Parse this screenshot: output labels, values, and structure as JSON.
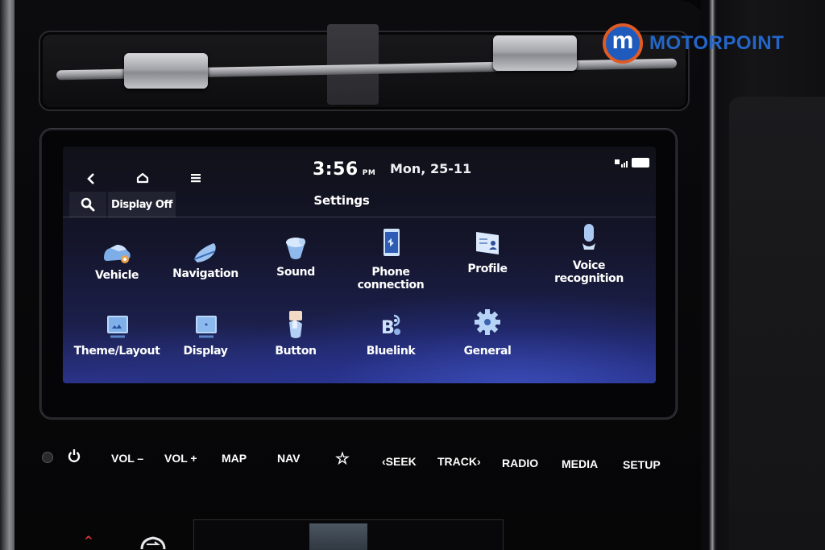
{
  "brand": {
    "logo_letter": "m",
    "logo_text": "MOTORPOINT",
    "colors": {
      "blue": "#1e5bbd",
      "orange": "#e05a24"
    }
  },
  "screen": {
    "statusbar": {
      "time": "3:56",
      "ampm": "PM",
      "date": "Mon, 25-11",
      "icons": [
        "back-icon",
        "home-icon",
        "menu-icon",
        "signal-icon",
        "battery-icon"
      ]
    },
    "toolbar": {
      "search_icon": "search-icon",
      "display_off_label": "Display Off",
      "title": "Settings"
    },
    "tiles": [
      {
        "label": "Vehicle",
        "icon": "vehicle-icon"
      },
      {
        "label": "Navigation",
        "icon": "navigation-icon"
      },
      {
        "label": "Sound",
        "icon": "speaker-icon"
      },
      {
        "label": "Phone\nconnection",
        "line1": "Phone",
        "line2": "connection",
        "icon": "phone-icon"
      },
      {
        "label": "Profile",
        "icon": "profile-card-icon"
      },
      {
        "label": "Voice\nrecognition",
        "line1": "Voice",
        "line2": "recognition",
        "icon": "microphone-icon"
      },
      {
        "label": "Theme/Layout",
        "icon": "theme-icon"
      },
      {
        "label": "Display",
        "icon": "display-icon"
      },
      {
        "label": "Button",
        "icon": "button-icon"
      },
      {
        "label": "Bluelink",
        "icon": "bluelink-icon"
      },
      {
        "label": "General",
        "icon": "gear-icon"
      }
    ]
  },
  "hardware_buttons": {
    "vol_down": "VOL –",
    "vol_up": "VOL +",
    "map": "MAP",
    "nav": "NAV",
    "favorite": "☆",
    "seek": "‹SEEK",
    "track": "TRACK›",
    "radio": "RADIO",
    "media": "MEDIA",
    "setup": "SETUP"
  }
}
